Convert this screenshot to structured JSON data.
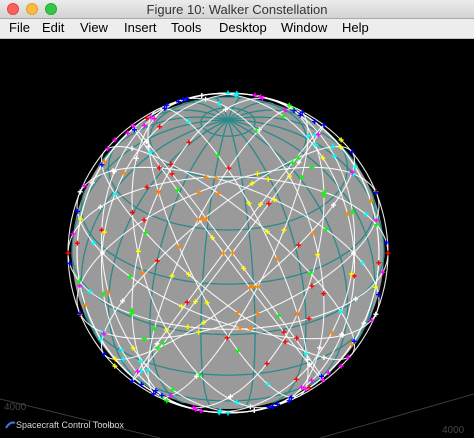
{
  "window": {
    "title": "Figure 10: Walker Constellation"
  },
  "menu": [
    "File",
    "Edit",
    "View",
    "Insert",
    "Tools",
    "Desktop",
    "Window",
    "Help"
  ],
  "plot": {
    "tick_left": "4000",
    "tick_right": "4000",
    "watermark": "Spacecraft Control Toolbox",
    "colors": {
      "background": "#000000",
      "planet": "#9a9a9a",
      "grid": "#2a8a8a",
      "orbits": "#ffffff",
      "satellites": [
        "#ff0000",
        "#ff8800",
        "#ffff00",
        "#00ff00",
        "#00ffff",
        "#0000ff",
        "#ff00ff",
        "#ffffff"
      ]
    }
  }
}
